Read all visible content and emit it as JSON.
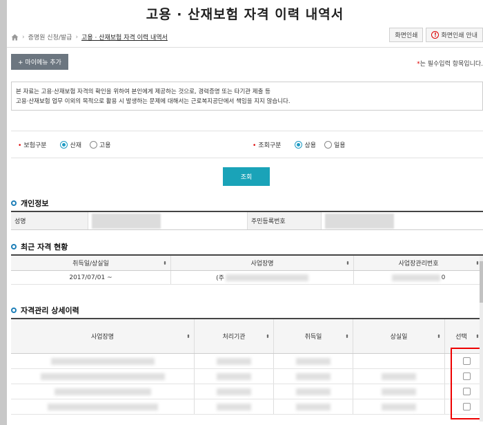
{
  "title": "고용 · 산재보험 자격 이력 내역서",
  "breadcrumb": {
    "level1": "증명원 신청/발급",
    "level2": "고용 · 산재보험 자격 이력 내역서"
  },
  "topbar": {
    "print_label": "화면인쇄",
    "print_guide_label": "화면인쇄 안내"
  },
  "mymenu_label": "+ 마이메뉴 추가",
  "required_note": {
    "star": "*",
    "text": "는 필수입력 항목입니다."
  },
  "notice": {
    "line1": "본 자료는 고용·산재보험 자격의 확인을 위하여 본인에게 제공하는 것으로, 경력증명 또는 타기관 제출 등",
    "line2": "고용·산재보험 업무 이외의 목적으로 활용 시 발생하는 문제에 대해서는 근로복지공단에서 책임을 지지 않습니다."
  },
  "filters": {
    "insurance": {
      "label": "보험구분",
      "options": [
        "산재",
        "고용"
      ],
      "selected": "산재"
    },
    "query": {
      "label": "조회구분",
      "options": [
        "상용",
        "일용"
      ],
      "selected": "상용"
    }
  },
  "search_label": "조회",
  "personal": {
    "section_title": "개인정보",
    "name_label": "성명",
    "rrn_label": "주민등록번호"
  },
  "recent": {
    "section_title": "최근 자격 현황",
    "columns": [
      "취득일/상실일",
      "사업장명",
      "사업장관리번호"
    ],
    "rows": [
      {
        "date": "2017/07/01 ~",
        "company_prefix": "(주",
        "mgmt_suffix": "0"
      }
    ]
  },
  "detail": {
    "section_title": "자격관리 상세이력",
    "columns": [
      "사업장명",
      "처리기관",
      "취득일",
      "상실일",
      "선택"
    ],
    "row_count": 4
  }
}
